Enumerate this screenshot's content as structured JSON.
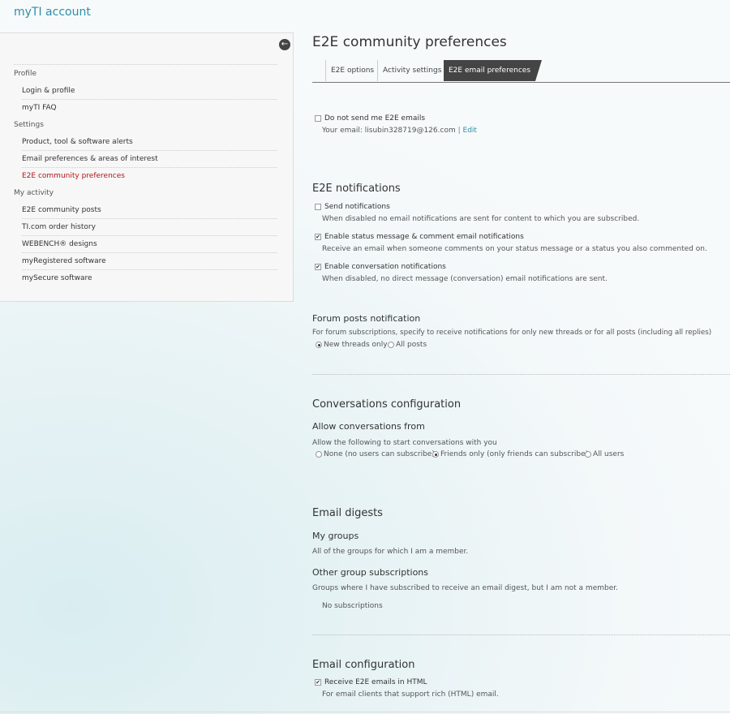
{
  "app": {
    "title": "myTI account"
  },
  "sidebar": {
    "items": [
      {
        "type": "group",
        "label": "Profile"
      },
      {
        "type": "item",
        "label": "Login & profile"
      },
      {
        "type": "item",
        "label": "myTI FAQ"
      },
      {
        "type": "group",
        "label": "Settings"
      },
      {
        "type": "item",
        "label": "Product, tool & software alerts"
      },
      {
        "type": "item",
        "label": "Email preferences & areas of interest"
      },
      {
        "type": "item",
        "label": "E2E community preferences",
        "active": true
      },
      {
        "type": "group",
        "label": "My activity"
      },
      {
        "type": "item",
        "label": "E2E community posts"
      },
      {
        "type": "item",
        "label": "TI.com order history"
      },
      {
        "type": "item",
        "label": "WEBENCH® designs"
      },
      {
        "type": "item",
        "label": "myRegistered software"
      },
      {
        "type": "item",
        "label": "mySecure software"
      }
    ]
  },
  "page": {
    "title": "E2E community preferences"
  },
  "tabs": [
    {
      "label": "E2E options"
    },
    {
      "label": "Activity settings"
    },
    {
      "label": "E2E email preferences",
      "active": true
    }
  ],
  "email_opt_out": {
    "label": "Do not send me E2E emails",
    "checked": false,
    "email_prefix": "Your email: lisubin328719@126.com",
    "separator": "|",
    "edit_label": "Edit"
  },
  "notifications": {
    "heading": "E2E notifications",
    "send": {
      "label": "Send notifications",
      "checked": false,
      "desc": "When disabled no email notifications are sent for content to which you are subscribed."
    },
    "status": {
      "label": "Enable status message & comment email notifications",
      "checked": true,
      "desc": "Receive an email when someone comments on your status message or a status you also commented on."
    },
    "conversation": {
      "label": "Enable conversation notifications",
      "checked": true,
      "desc": "When disabled, no direct message (conversation) email notifications are sent."
    }
  },
  "forum": {
    "heading": "Forum posts notification",
    "desc": "For forum subscriptions, specify to receive notifications for only new threads or for all posts (including all replies)",
    "options": [
      {
        "label": "New threads only",
        "selected": true
      },
      {
        "label": "All posts",
        "selected": false
      }
    ]
  },
  "conversations": {
    "heading": "Conversations configuration",
    "subheading": "Allow conversations from",
    "desc": "Allow the following to start conversations with you",
    "options": [
      {
        "label": "None (no users can subscribe)",
        "selected": false
      },
      {
        "label": "Friends only (only friends can subscribe)",
        "selected": true
      },
      {
        "label": "All users",
        "selected": false
      }
    ]
  },
  "digests": {
    "heading": "Email digests",
    "my_groups_heading": "My groups",
    "my_groups_desc": "All of the groups for which I am a member.",
    "other_heading": "Other group subscriptions",
    "other_desc": "Groups where I have subscribed to receive an email digest, but I am not a member.",
    "empty": "No subscriptions"
  },
  "email_config": {
    "heading": "Email configuration",
    "html": {
      "label": "Receive E2E emails in HTML",
      "checked": true,
      "desc": "For email clients that support rich (HTML) email."
    }
  },
  "icons": {
    "collapse": "arrow-left-circle-icon",
    "check": "checkmark-icon"
  },
  "colors": {
    "accent": "#2e8fa8",
    "active": "#b4141b",
    "tab_active_bg": "#444444"
  }
}
